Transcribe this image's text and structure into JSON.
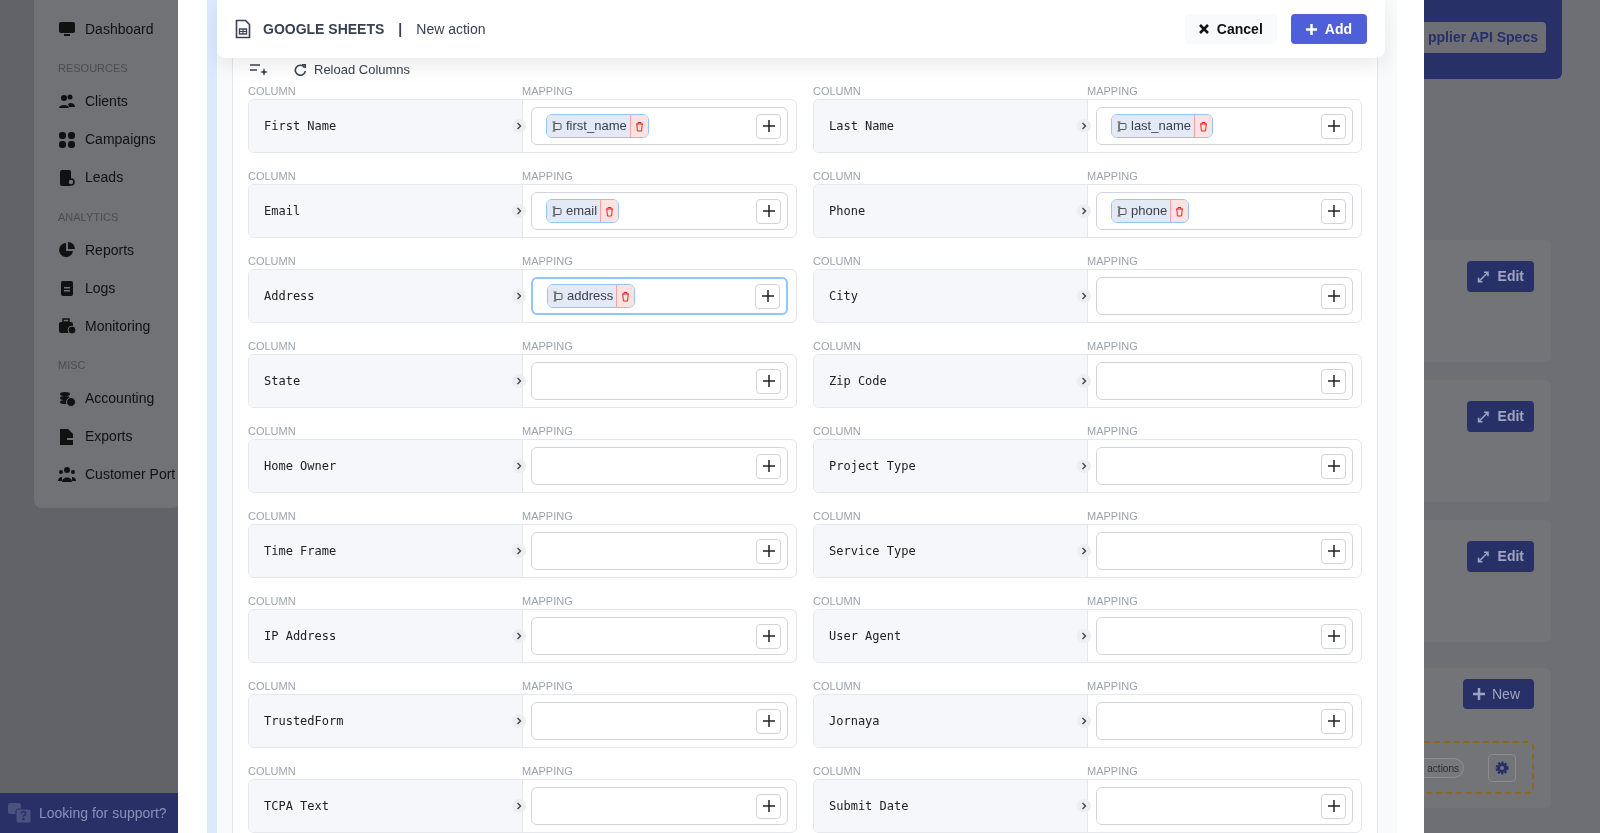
{
  "sidebar": {
    "items": [
      {
        "kind": "link",
        "label": "Dashboard"
      },
      {
        "kind": "section",
        "label": "RESOURCES"
      },
      {
        "kind": "link",
        "label": "Clients"
      },
      {
        "kind": "link",
        "label": "Campaigns"
      },
      {
        "kind": "link",
        "label": "Leads"
      },
      {
        "kind": "section",
        "label": "ANALYTICS"
      },
      {
        "kind": "link",
        "label": "Reports"
      },
      {
        "kind": "link",
        "label": "Logs"
      },
      {
        "kind": "link",
        "label": "Monitoring"
      },
      {
        "kind": "section",
        "label": "MISC"
      },
      {
        "kind": "link",
        "label": "Accounting"
      },
      {
        "kind": "link",
        "label": "Exports"
      },
      {
        "kind": "link",
        "label": "Customer Port"
      }
    ],
    "support": "Looking for support?"
  },
  "background": {
    "header_button": "pplier API Specs",
    "edit_buttons": [
      "Edit",
      "Edit",
      "Edit"
    ],
    "new_button": "New",
    "chip": "actions"
  },
  "modal": {
    "title": "GOOGLE SHEETS",
    "separator": "|",
    "subtitle": "New action",
    "cancel": "Cancel",
    "add": "Add",
    "reload": "Reload Columns",
    "fields": [
      {
        "column_label": "COLUMN",
        "column": "First Name",
        "mapping_label": "MAPPING",
        "tag": "first_name",
        "focused": false
      },
      {
        "column_label": "COLUMN",
        "column": "Last Name",
        "mapping_label": "MAPPING",
        "tag": "last_name",
        "focused": false
      },
      {
        "column_label": "COLUMN",
        "column": "Email",
        "mapping_label": "MAPPING",
        "tag": "email",
        "focused": false
      },
      {
        "column_label": "COLUMN",
        "column": "Phone",
        "mapping_label": "MAPPING",
        "tag": "phone",
        "focused": false
      },
      {
        "column_label": "COLUMN",
        "column": "Address",
        "mapping_label": "MAPPING",
        "tag": "address",
        "focused": true
      },
      {
        "column_label": "COLUMN",
        "column": "City",
        "mapping_label": "MAPPING",
        "focused": false
      },
      {
        "column_label": "COLUMN",
        "column": "State",
        "mapping_label": "MAPPING",
        "focused": false
      },
      {
        "column_label": "COLUMN",
        "column": "Zip Code",
        "mapping_label": "MAPPING",
        "focused": false
      },
      {
        "column_label": "COLUMN",
        "column": "Home Owner",
        "mapping_label": "MAPPING",
        "focused": false
      },
      {
        "column_label": "COLUMN",
        "column": "Project Type",
        "mapping_label": "MAPPING",
        "focused": false
      },
      {
        "column_label": "COLUMN",
        "column": "Time Frame",
        "mapping_label": "MAPPING",
        "focused": false
      },
      {
        "column_label": "COLUMN",
        "column": "Service Type",
        "mapping_label": "MAPPING",
        "focused": false
      },
      {
        "column_label": "COLUMN",
        "column": "IP Address",
        "mapping_label": "MAPPING",
        "focused": false
      },
      {
        "column_label": "COLUMN",
        "column": "User Agent",
        "mapping_label": "MAPPING",
        "focused": false
      },
      {
        "column_label": "COLUMN",
        "column": "TrustedForm",
        "mapping_label": "MAPPING",
        "focused": false
      },
      {
        "column_label": "COLUMN",
        "column": "Jornaya",
        "mapping_label": "MAPPING",
        "focused": false
      },
      {
        "column_label": "COLUMN",
        "column": "TCPA Text",
        "mapping_label": "MAPPING",
        "focused": false
      },
      {
        "column_label": "COLUMN",
        "column": "Submit Date",
        "mapping_label": "MAPPING",
        "focused": false
      }
    ]
  }
}
